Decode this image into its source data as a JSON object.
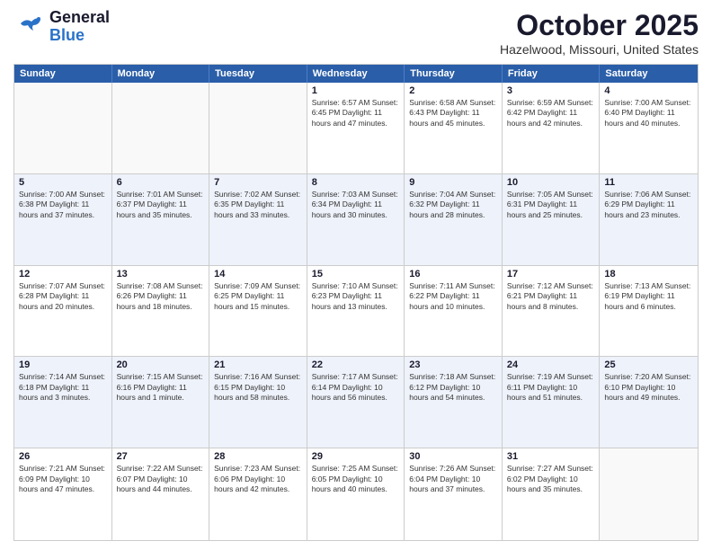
{
  "header": {
    "logo_general": "General",
    "logo_blue": "Blue",
    "month": "October 2025",
    "location": "Hazelwood, Missouri, United States"
  },
  "days_of_week": [
    "Sunday",
    "Monday",
    "Tuesday",
    "Wednesday",
    "Thursday",
    "Friday",
    "Saturday"
  ],
  "weeks": [
    [
      {
        "day": "",
        "info": "",
        "empty": true
      },
      {
        "day": "",
        "info": "",
        "empty": true
      },
      {
        "day": "",
        "info": "",
        "empty": true
      },
      {
        "day": "1",
        "info": "Sunrise: 6:57 AM\nSunset: 6:45 PM\nDaylight: 11 hours\nand 47 minutes."
      },
      {
        "day": "2",
        "info": "Sunrise: 6:58 AM\nSunset: 6:43 PM\nDaylight: 11 hours\nand 45 minutes."
      },
      {
        "day": "3",
        "info": "Sunrise: 6:59 AM\nSunset: 6:42 PM\nDaylight: 11 hours\nand 42 minutes."
      },
      {
        "day": "4",
        "info": "Sunrise: 7:00 AM\nSunset: 6:40 PM\nDaylight: 11 hours\nand 40 minutes."
      }
    ],
    [
      {
        "day": "5",
        "info": "Sunrise: 7:00 AM\nSunset: 6:38 PM\nDaylight: 11 hours\nand 37 minutes."
      },
      {
        "day": "6",
        "info": "Sunrise: 7:01 AM\nSunset: 6:37 PM\nDaylight: 11 hours\nand 35 minutes."
      },
      {
        "day": "7",
        "info": "Sunrise: 7:02 AM\nSunset: 6:35 PM\nDaylight: 11 hours\nand 33 minutes."
      },
      {
        "day": "8",
        "info": "Sunrise: 7:03 AM\nSunset: 6:34 PM\nDaylight: 11 hours\nand 30 minutes."
      },
      {
        "day": "9",
        "info": "Sunrise: 7:04 AM\nSunset: 6:32 PM\nDaylight: 11 hours\nand 28 minutes."
      },
      {
        "day": "10",
        "info": "Sunrise: 7:05 AM\nSunset: 6:31 PM\nDaylight: 11 hours\nand 25 minutes."
      },
      {
        "day": "11",
        "info": "Sunrise: 7:06 AM\nSunset: 6:29 PM\nDaylight: 11 hours\nand 23 minutes."
      }
    ],
    [
      {
        "day": "12",
        "info": "Sunrise: 7:07 AM\nSunset: 6:28 PM\nDaylight: 11 hours\nand 20 minutes."
      },
      {
        "day": "13",
        "info": "Sunrise: 7:08 AM\nSunset: 6:26 PM\nDaylight: 11 hours\nand 18 minutes."
      },
      {
        "day": "14",
        "info": "Sunrise: 7:09 AM\nSunset: 6:25 PM\nDaylight: 11 hours\nand 15 minutes."
      },
      {
        "day": "15",
        "info": "Sunrise: 7:10 AM\nSunset: 6:23 PM\nDaylight: 11 hours\nand 13 minutes."
      },
      {
        "day": "16",
        "info": "Sunrise: 7:11 AM\nSunset: 6:22 PM\nDaylight: 11 hours\nand 10 minutes."
      },
      {
        "day": "17",
        "info": "Sunrise: 7:12 AM\nSunset: 6:21 PM\nDaylight: 11 hours\nand 8 minutes."
      },
      {
        "day": "18",
        "info": "Sunrise: 7:13 AM\nSunset: 6:19 PM\nDaylight: 11 hours\nand 6 minutes."
      }
    ],
    [
      {
        "day": "19",
        "info": "Sunrise: 7:14 AM\nSunset: 6:18 PM\nDaylight: 11 hours\nand 3 minutes."
      },
      {
        "day": "20",
        "info": "Sunrise: 7:15 AM\nSunset: 6:16 PM\nDaylight: 11 hours\nand 1 minute."
      },
      {
        "day": "21",
        "info": "Sunrise: 7:16 AM\nSunset: 6:15 PM\nDaylight: 10 hours\nand 58 minutes."
      },
      {
        "day": "22",
        "info": "Sunrise: 7:17 AM\nSunset: 6:14 PM\nDaylight: 10 hours\nand 56 minutes."
      },
      {
        "day": "23",
        "info": "Sunrise: 7:18 AM\nSunset: 6:12 PM\nDaylight: 10 hours\nand 54 minutes."
      },
      {
        "day": "24",
        "info": "Sunrise: 7:19 AM\nSunset: 6:11 PM\nDaylight: 10 hours\nand 51 minutes."
      },
      {
        "day": "25",
        "info": "Sunrise: 7:20 AM\nSunset: 6:10 PM\nDaylight: 10 hours\nand 49 minutes."
      }
    ],
    [
      {
        "day": "26",
        "info": "Sunrise: 7:21 AM\nSunset: 6:09 PM\nDaylight: 10 hours\nand 47 minutes."
      },
      {
        "day": "27",
        "info": "Sunrise: 7:22 AM\nSunset: 6:07 PM\nDaylight: 10 hours\nand 44 minutes."
      },
      {
        "day": "28",
        "info": "Sunrise: 7:23 AM\nSunset: 6:06 PM\nDaylight: 10 hours\nand 42 minutes."
      },
      {
        "day": "29",
        "info": "Sunrise: 7:25 AM\nSunset: 6:05 PM\nDaylight: 10 hours\nand 40 minutes."
      },
      {
        "day": "30",
        "info": "Sunrise: 7:26 AM\nSunset: 6:04 PM\nDaylight: 10 hours\nand 37 minutes."
      },
      {
        "day": "31",
        "info": "Sunrise: 7:27 AM\nSunset: 6:02 PM\nDaylight: 10 hours\nand 35 minutes."
      },
      {
        "day": "",
        "info": "",
        "empty": true
      }
    ]
  ]
}
